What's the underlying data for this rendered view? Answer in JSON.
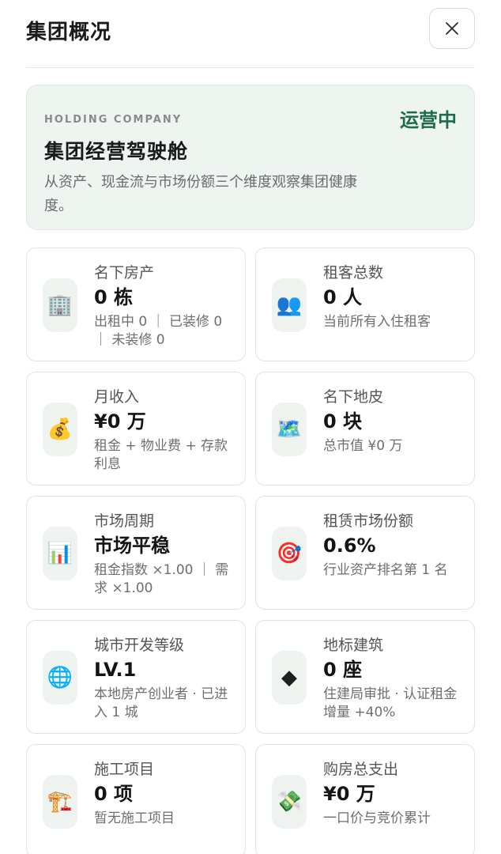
{
  "header": {
    "title": "集团概况"
  },
  "hero": {
    "eyebrow": "HOLDING COMPANY",
    "status": "运营中",
    "title": "集团经营驾驶舱",
    "description": "从资产、现金流与市场份额三个维度观察集团健康度。"
  },
  "cards": [
    {
      "icon": "🏢",
      "icon_name": "office-building-icon",
      "label": "名下房产",
      "value": "0 栋",
      "note": "出租中 0 ｜ 已装修 0 ｜ 未装修 0"
    },
    {
      "icon": "👥",
      "icon_name": "people-icon",
      "label": "租客总数",
      "value": "0 人",
      "note": "当前所有入住租客"
    },
    {
      "icon": "💰",
      "icon_name": "money-bag-icon",
      "label": "月收入",
      "value": "¥0 万",
      "note": "租金 + 物业费 + 存款利息"
    },
    {
      "icon": "🗺️",
      "icon_name": "map-icon",
      "label": "名下地皮",
      "value": "0 块",
      "note": "总市值 ¥0 万"
    },
    {
      "icon": "📊",
      "icon_name": "bar-chart-icon",
      "label": "市场周期",
      "value": "市场平稳",
      "note": "租金指数 ×1.00 ｜ 需求 ×1.00"
    },
    {
      "icon": "🎯",
      "icon_name": "target-icon",
      "label": "租赁市场份额",
      "value": "0.6%",
      "note": "行业资产排名第 1 名"
    },
    {
      "icon": "🌐",
      "icon_name": "globe-icon",
      "label": "城市开发等级",
      "value": "LV.1",
      "note": "本地房产创业者 · 已进入 1 城"
    },
    {
      "icon": "◆",
      "icon_name": "diamond-icon",
      "label": "地标建筑",
      "value": "0 座",
      "note": "住建局审批 · 认证租金增量 +40%"
    },
    {
      "icon": "🏗️",
      "icon_name": "construction-crane-icon",
      "label": "施工项目",
      "value": "0 项",
      "note": "暂无施工项目"
    },
    {
      "icon": "💸",
      "icon_name": "money-wings-icon",
      "label": "购房总支出",
      "value": "¥0 万",
      "note": "一口价与竞价累计"
    }
  ]
}
